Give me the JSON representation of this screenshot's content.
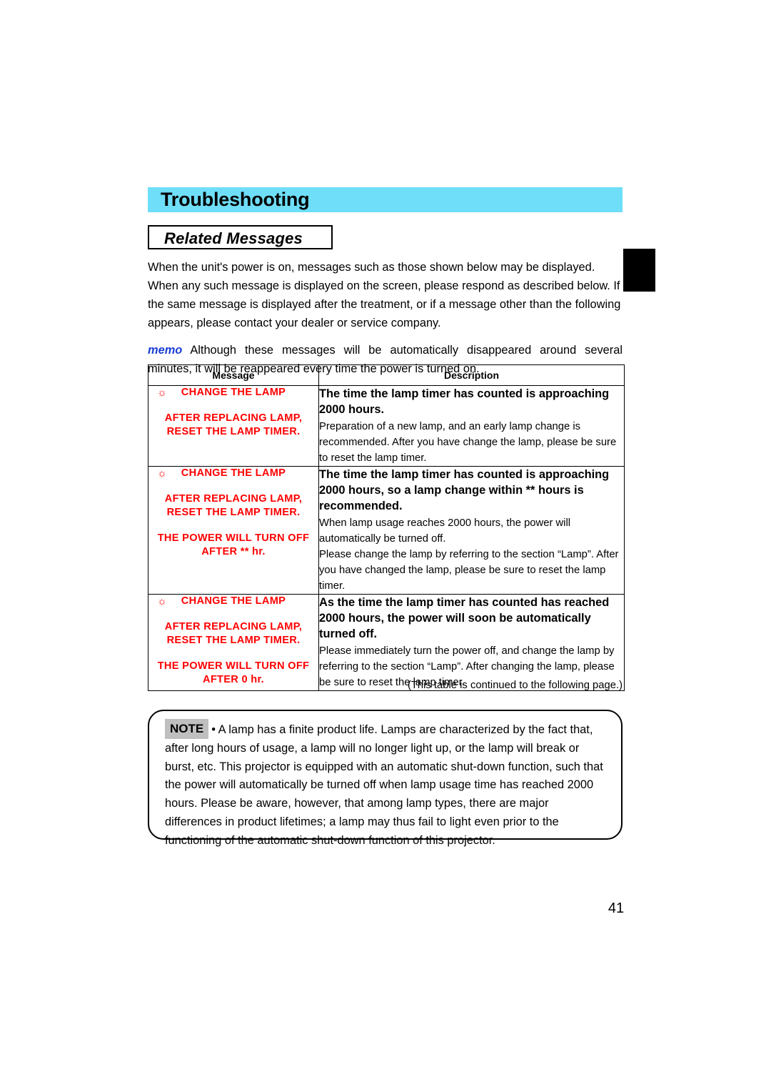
{
  "chapter": {
    "title": "Troubleshooting",
    "bar_color": "#6fdef8"
  },
  "section": {
    "title": "Related Messages"
  },
  "intro": {
    "paragraph_1": "When the unit's power is on, messages such as those shown below may be displayed. When any such message is displayed on the screen, please respond as described below. If the same message is displayed after the treatment, or if a message other than the following appears, please contact your dealer or service company.",
    "memo_label": "memo",
    "paragraph_2": "Although these messages will be automatically disappeared around several minutes, it will be reappeared every time the power is turned on.",
    "memo_color": "#1a3fd6"
  },
  "table": {
    "headers": {
      "message": "Message",
      "description": "Description"
    },
    "message_color": "#ff0000",
    "lamp_icon": "sun-icon",
    "rows": [
      {
        "message_lines": [
          "CHANGE THE LAMP",
          "AFTER REPLACING LAMP,",
          "RESET THE LAMP TIMER."
        ],
        "description_head": "The time the lamp timer has counted is approaching 2000 hours.",
        "description_body": [
          "Preparation of a new lamp, and an early lamp change is recommended. After you have change the lamp, please be sure to reset the lamp timer."
        ]
      },
      {
        "message_lines": [
          "CHANGE THE LAMP",
          "AFTER REPLACING LAMP,",
          "RESET THE LAMP TIMER.",
          "THE POWER WILL TURN OFF",
          "AFTER ** hr."
        ],
        "description_head": "The time the lamp timer has counted is approaching 2000 hours, so a lamp change within ** hours is recommended.",
        "description_body": [
          "When lamp usage reaches 2000 hours, the power will automatically be turned off.",
          "Please change the lamp by referring to the section “Lamp”. After you have changed the lamp, please be sure to reset the lamp timer."
        ]
      },
      {
        "message_lines": [
          "CHANGE THE LAMP",
          "AFTER REPLACING LAMP,",
          "RESET THE LAMP TIMER.",
          "THE POWER WILL TURN OFF",
          "AFTER 0 hr."
        ],
        "description_head": "As the time the lamp timer has counted has reached 2000 hours, the power will soon be automatically turned off.",
        "description_body": [
          "Please immediately turn the power off, and change the lamp by referring to the section “Lamp”. After changing the lamp, please be sure to reset the lamp timer."
        ]
      }
    ],
    "continued_note": "(This table is continued to the following page.)"
  },
  "note": {
    "label": "NOTE",
    "text": "• A lamp has a finite product life. Lamps are characterized by the fact that, after long hours of usage, a lamp will no longer light up, or the lamp will break or burst, etc. This projector is equipped with an automatic shut-down function, such that the power will automatically be turned off when lamp usage time has reached 2000 hours. Please be aware, however, that among lamp types, there are major differences in product lifetimes; a lamp may thus fail to light even prior to the functioning of the automatic shut-down function of this projector."
  },
  "page_number": "41"
}
